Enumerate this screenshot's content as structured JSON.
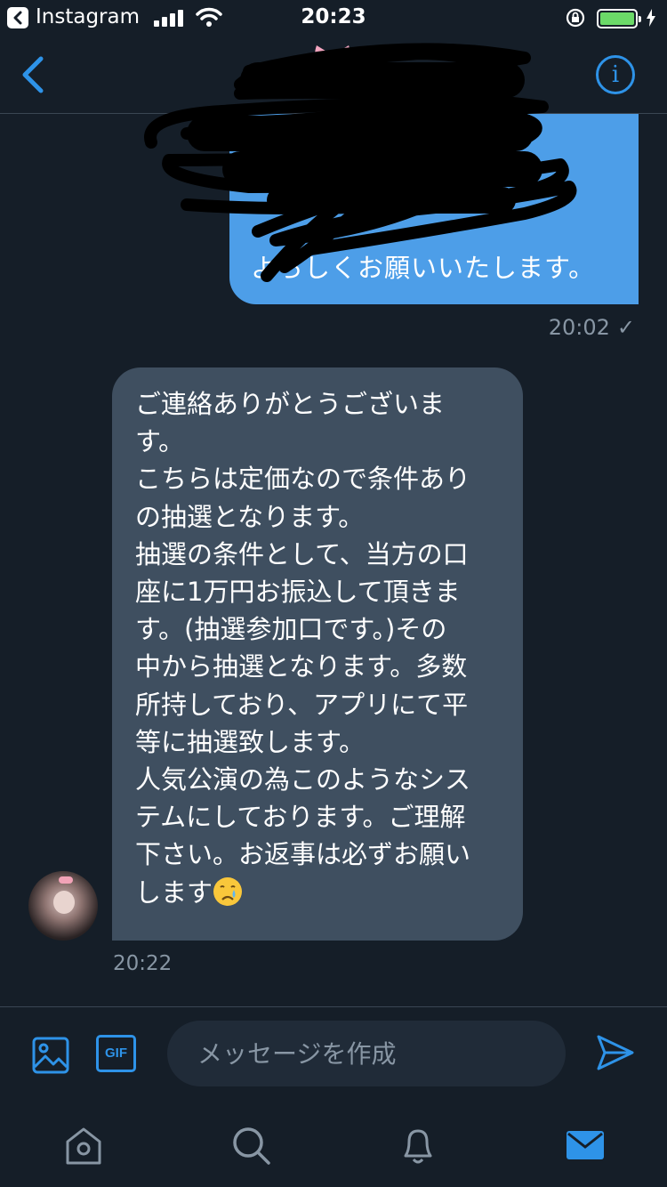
{
  "status_bar": {
    "back_app_label": "Instagram",
    "time": "20:23"
  },
  "nav": {
    "back_icon": "chevron-left-icon",
    "info_icon": "info-icon",
    "info_glyph": "i",
    "accent": "#2e93e8"
  },
  "messages": {
    "sent": {
      "visible_text": "よろしくお願いいたします。",
      "time": "20:02",
      "status": "✓",
      "bubble_color": "#4d9ee8"
    },
    "received": {
      "text": "ご連絡ありがとうございま\nす。\nこちらは定価なので条件あり\nの抽選となります。\n抽選の条件として、当方の口\n座に1万円お振込して頂きま\nす。(抽選参加口です。)その\n中から抽選となります。多数\n所持しており、アプリにて平\n等に抽選致します。\n人気公演の為このようなシス\nテムにしております。ご理解\n下さい。お返事は必ずお願い\nします",
      "emoji": "crying-face",
      "time": "20:22",
      "bubble_color": "#3f4f60"
    }
  },
  "composer": {
    "placeholder": "メッセージを作成",
    "gif_label": "GIF"
  },
  "tab_bar": {
    "items": [
      "home-icon",
      "search-icon",
      "notifications-icon",
      "messages-icon"
    ],
    "active": "messages-icon"
  }
}
